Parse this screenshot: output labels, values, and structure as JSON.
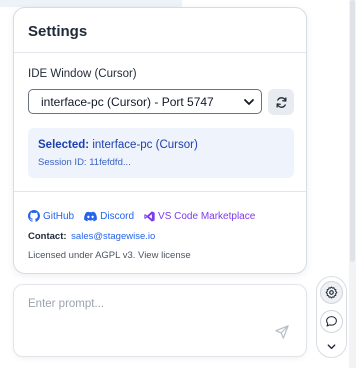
{
  "settings_panel": {
    "title": "Settings",
    "ide_section": {
      "label": "IDE Window (Cursor)",
      "selected_option": "interface-pc (Cursor) - Port 5747"
    },
    "selected_info": {
      "label": "Selected:",
      "value": "interface-pc (Cursor)",
      "session": "Session ID: 11fefdfd..."
    },
    "links": {
      "github": "GitHub",
      "discord": "Discord",
      "vscode": "VS Code Marketplace"
    },
    "contact": {
      "label": "Contact:",
      "email": "sales@stagewise.io"
    },
    "license": "Licensed under AGPL v3. View license"
  },
  "prompt": {
    "placeholder": "Enter prompt..."
  },
  "colors": {
    "accent_blue": "#2563eb",
    "vscode_purple": "#7c3aed",
    "selected_bg": "#eef3fc"
  },
  "icons": [
    "chevron-down-icon",
    "refresh-icon",
    "github-icon",
    "discord-icon",
    "vscode-icon",
    "send-icon",
    "gear-icon",
    "chat-icon"
  ]
}
